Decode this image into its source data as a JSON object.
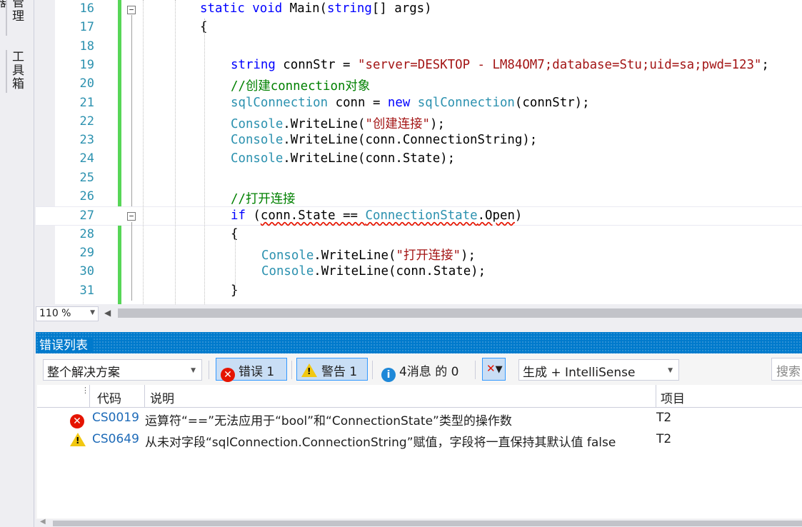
{
  "side_tabs": [
    "管理器",
    "工具箱"
  ],
  "editor": {
    "lines": [
      {
        "n": "16",
        "parts": [
          [
            "kw",
            "static "
          ],
          [
            "kw",
            "void "
          ],
          [
            "",
            "Main("
          ],
          [
            "kw",
            "string"
          ],
          [
            "",
            "[] args)"
          ]
        ]
      },
      {
        "n": "17",
        "parts": [
          [
            "",
            "{"
          ]
        ]
      },
      {
        "n": "18",
        "parts": []
      },
      {
        "n": "19",
        "parts": [
          [
            "kw",
            "string "
          ],
          [
            "",
            "connStr = "
          ],
          [
            "st",
            "\"server=DESKTOP - LM84OM7;database=Stu;uid=sa;pwd=123\""
          ],
          [
            "",
            ";"
          ]
        ]
      },
      {
        "n": "20",
        "parts": [
          [
            "cm",
            "//创建connection对象"
          ]
        ]
      },
      {
        "n": "21",
        "parts": [
          [
            "ty",
            "sqlConnection "
          ],
          [
            "",
            "conn = "
          ],
          [
            "kw",
            "new "
          ],
          [
            "ty",
            "sqlConnection"
          ],
          [
            "",
            "(connStr);"
          ]
        ]
      },
      {
        "n": "22",
        "parts": [
          [
            "ty",
            "Console"
          ],
          [
            "",
            ".WriteLine("
          ],
          [
            "st",
            "\"创建连接\""
          ],
          [
            "",
            ");"
          ]
        ]
      },
      {
        "n": "23",
        "parts": [
          [
            "ty",
            "Console"
          ],
          [
            "",
            ".WriteLine(conn.ConnectionString);"
          ]
        ]
      },
      {
        "n": "24",
        "parts": [
          [
            "ty",
            "Console"
          ],
          [
            "",
            ".WriteLine(conn.State);"
          ]
        ]
      },
      {
        "n": "25",
        "parts": []
      },
      {
        "n": "26",
        "parts": [
          [
            "cm",
            "//打开连接"
          ]
        ]
      },
      {
        "n": "27",
        "parts": [
          [
            "kw",
            "if "
          ],
          [
            "",
            "("
          ],
          [
            "sq",
            "conn.State == "
          ],
          [
            "tysq",
            "ConnectionState"
          ],
          [
            "sq",
            ".Open"
          ],
          [
            "",
            ")"
          ]
        ]
      },
      {
        "n": "28",
        "parts": [
          [
            "",
            "{"
          ]
        ]
      },
      {
        "n": "29",
        "parts": [
          [
            "ty",
            "Console"
          ],
          [
            "",
            ".WriteLine("
          ],
          [
            "st",
            "\"打开连接\""
          ],
          [
            "",
            ");"
          ]
        ]
      },
      {
        "n": "30",
        "parts": [
          [
            "ty",
            "Console"
          ],
          [
            "",
            ".WriteLine(conn.State);"
          ]
        ]
      },
      {
        "n": "31",
        "parts": [
          [
            "",
            "}"
          ]
        ]
      }
    ]
  },
  "zoom": "110 %",
  "error_list": {
    "title": "错误列表",
    "scope": "整个解决方案",
    "errors_btn": "错误 1",
    "warnings_btn": "警告 1",
    "messages_btn": "4消息 的 0",
    "source": "生成 + IntelliSense",
    "search_placeholder": "搜索",
    "columns": {
      "code": "代码",
      "desc": "说明",
      "project": "项目"
    },
    "rows": [
      {
        "severity": "error",
        "code": "CS0019",
        "desc": "运算符“==”无法应用于“bool”和“ConnectionState”类型的操作数",
        "project": "T2"
      },
      {
        "severity": "warning",
        "code": "CS0649",
        "desc": "从未对字段“sqlConnection.ConnectionString”赋值，字段将一直保持其默认值 false",
        "project": "T2"
      }
    ]
  }
}
